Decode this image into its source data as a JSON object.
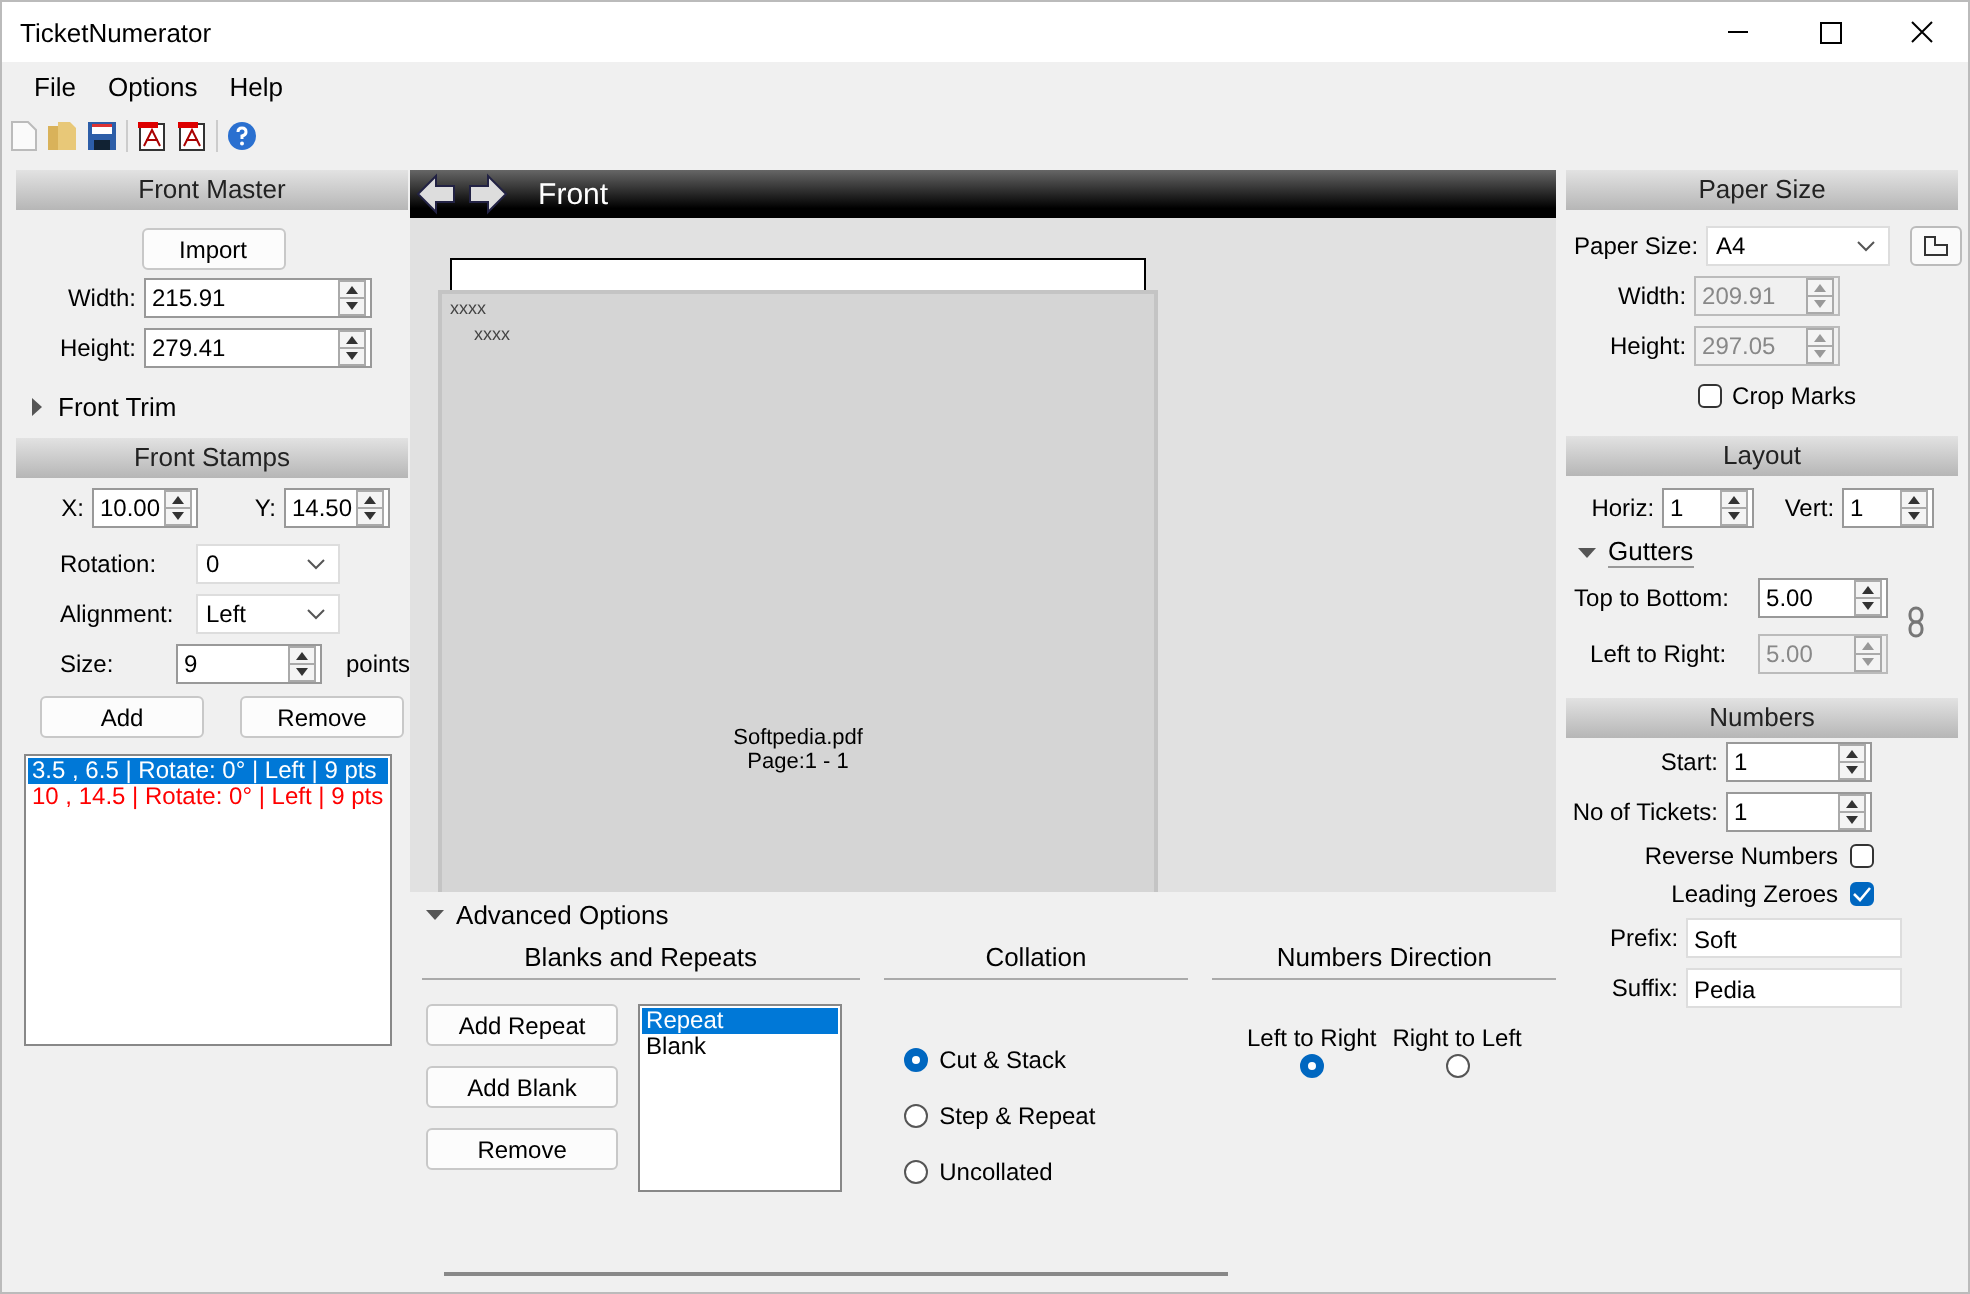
{
  "window": {
    "title": "TicketNumerator"
  },
  "menu": [
    "File",
    "Options",
    "Help"
  ],
  "front_master": {
    "title": "Front Master",
    "import_button": "Import",
    "width": {
      "label": "Width:",
      "value": "215.91"
    },
    "height": {
      "label": "Height:",
      "value": "279.41"
    }
  },
  "front_trim": {
    "label": "Front Trim",
    "expanded": false
  },
  "front_stamps": {
    "title": "Front Stamps",
    "x": {
      "label": "X:",
      "value": "10.00"
    },
    "y": {
      "label": "Y:",
      "value": "14.50"
    },
    "rotation": {
      "label": "Rotation:",
      "value": "0"
    },
    "alignment": {
      "label": "Alignment:",
      "value": "Left"
    },
    "size": {
      "label": "Size:",
      "value": "9",
      "unit": "points"
    },
    "add_button": "Add",
    "remove_button": "Remove",
    "stamps": [
      {
        "text": "3.5 , 6.5 | Rotate: 0° | Left | 9 pts",
        "selected": true,
        "color": "#ffffff"
      },
      {
        "text": "10 , 14.5 | Rotate: 0° | Left | 9 pts",
        "selected": false,
        "color": "#ff0000"
      }
    ]
  },
  "preview": {
    "title": "Front",
    "stamp_marks": [
      "xxxx",
      "xxxx"
    ],
    "file_name": "Softpedia.pdf",
    "page": "Page:1 - 1"
  },
  "advanced_options": {
    "label": "Advanced Options",
    "expanded": true
  },
  "blanks_and_repeats": {
    "title": "Blanks and Repeats",
    "buttons": [
      "Add Repeat",
      "Add Blank",
      "Remove"
    ],
    "items": [
      {
        "text": "Repeat",
        "selected": true
      },
      {
        "text": "Blank",
        "selected": false
      }
    ]
  },
  "collation": {
    "title": "Collation",
    "options": [
      {
        "label": "Cut & Stack",
        "selected": true
      },
      {
        "label": "Step & Repeat",
        "selected": false
      },
      {
        "label": "Uncollated",
        "selected": false
      }
    ]
  },
  "numbers_direction": {
    "title": "Numbers Direction",
    "options": [
      {
        "label": "Left to Right",
        "selected": true
      },
      {
        "label": "Right to Left",
        "selected": false
      }
    ]
  },
  "paper_size": {
    "title": "Paper Size",
    "label": "Paper Size:",
    "value": "A4",
    "width": {
      "label": "Width:",
      "value": "209.91",
      "disabled": true
    },
    "height": {
      "label": "Height:",
      "value": "297.05",
      "disabled": true
    },
    "crop_marks": {
      "label": "Crop Marks",
      "checked": false
    }
  },
  "layout": {
    "title": "Layout",
    "horiz": {
      "label": "Horiz:",
      "value": "1"
    },
    "vert": {
      "label": "Vert:",
      "value": "1"
    },
    "gutters": {
      "label": "Gutters",
      "expanded": true
    },
    "top_to_bottom": {
      "label": "Top to Bottom:",
      "value": "5.00",
      "disabled": false
    },
    "left_to_right": {
      "label": "Left to Right:",
      "value": "5.00",
      "disabled": true
    }
  },
  "numbers": {
    "title": "Numbers",
    "start": {
      "label": "Start:",
      "value": "1"
    },
    "no_of_tickets": {
      "label": "No of Tickets:",
      "value": "1"
    },
    "reverse_numbers": {
      "label": "Reverse Numbers",
      "checked": false
    },
    "leading_zeroes": {
      "label": "Leading Zeroes",
      "checked": true
    },
    "prefix": {
      "label": "Prefix:",
      "value": "Soft"
    },
    "suffix": {
      "label": "Suffix:",
      "value": "Pedia"
    }
  }
}
